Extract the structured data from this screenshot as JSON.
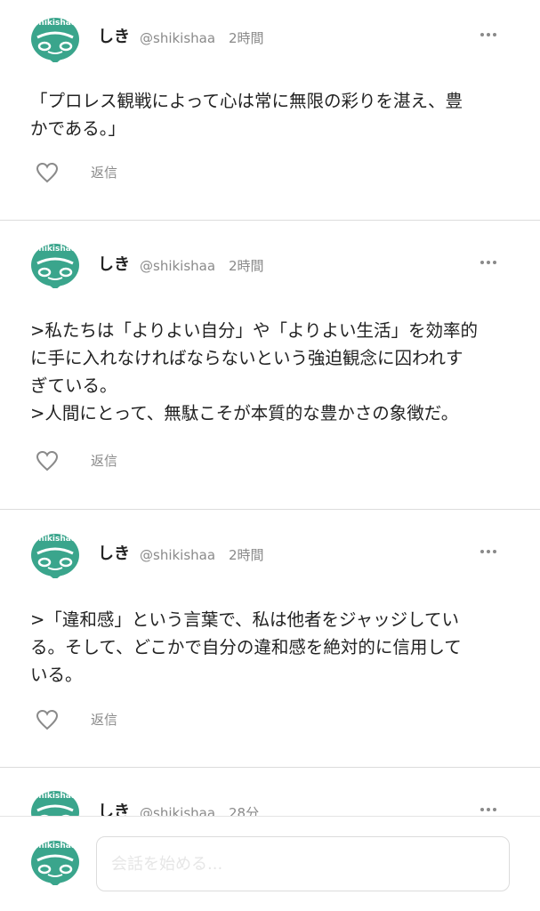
{
  "posts": [
    {
      "name": "しき",
      "handle": "@shikishaa",
      "time": "2時間",
      "text": "「プロレス観戦によって心は常に無限の彩りを湛え、豊\nかである。」",
      "reply_label": "返信"
    },
    {
      "name": "しき",
      "handle": "@shikishaa",
      "time": "2時間",
      "text": ">私たちは「よりよい自分」や「よりよい生活」を効率的\nに手に入れなければならないという強迫観念に囚われす\nぎている。\n>人間にとって、無駄こそが本質的な豊かさの象徴だ。",
      "reply_label": "返信"
    },
    {
      "name": "しき",
      "handle": "@shikishaa",
      "time": "2時間",
      "text": ">「違和感」という言葉で、私は他者をジャッジしてい\nる。そして、どこかで自分の違和感を絶対的に信用して\nいる。",
      "reply_label": "返信"
    },
    {
      "name": "しき",
      "handle": "@shikishaa",
      "time": "28分"
    }
  ],
  "avatar": {
    "logo_text": "shikishaa",
    "color": "#3aa58c"
  },
  "composer": {
    "placeholder": "会話を始める..."
  },
  "colors": {
    "text": "#222222",
    "muted": "#8a8a8a",
    "divider": "#dcdcdc",
    "accent": "#3aa58c"
  }
}
